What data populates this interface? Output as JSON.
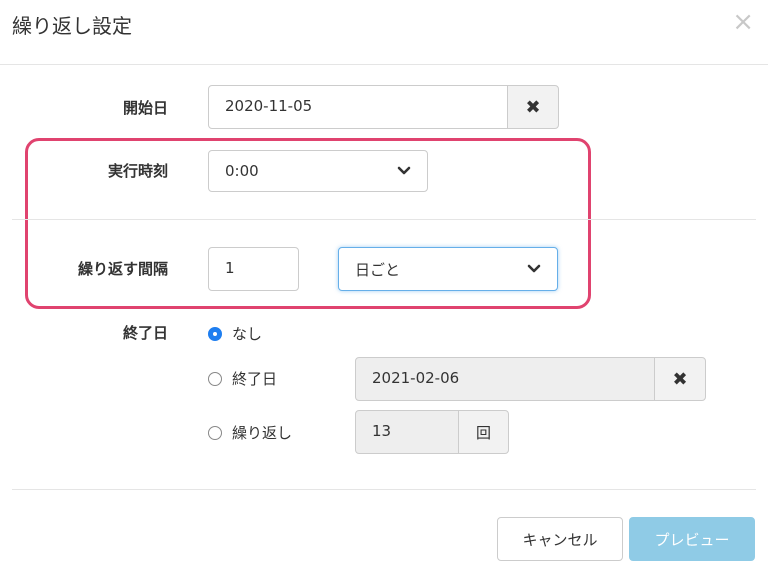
{
  "dialog": {
    "title": "繰り返し設定",
    "close_glyph": "×"
  },
  "start_date": {
    "label": "開始日",
    "value": "2020-11-05",
    "clear_glyph": "✖"
  },
  "run_time": {
    "label": "実行時刻",
    "selected": "0:00"
  },
  "interval": {
    "label": "繰り返す間隔",
    "value": "1",
    "unit_selected": "日ごと"
  },
  "end": {
    "label": "終了日",
    "options": [
      {
        "label": "なし",
        "checked": true
      },
      {
        "label": "終了日",
        "checked": false
      },
      {
        "label": "繰り返し",
        "checked": false
      }
    ],
    "end_date_value": "2021-02-06",
    "clear_glyph": "✖",
    "repeat_count": "13",
    "repeat_unit": "回"
  },
  "footer": {
    "cancel_label": "キャンセル",
    "preview_label": "プレビュー"
  },
  "colors": {
    "highlight": "#e0436f",
    "primary_button": "#8fcbe6",
    "radio_checked": "#1e7ef0",
    "focus_border": "#66afe9"
  }
}
